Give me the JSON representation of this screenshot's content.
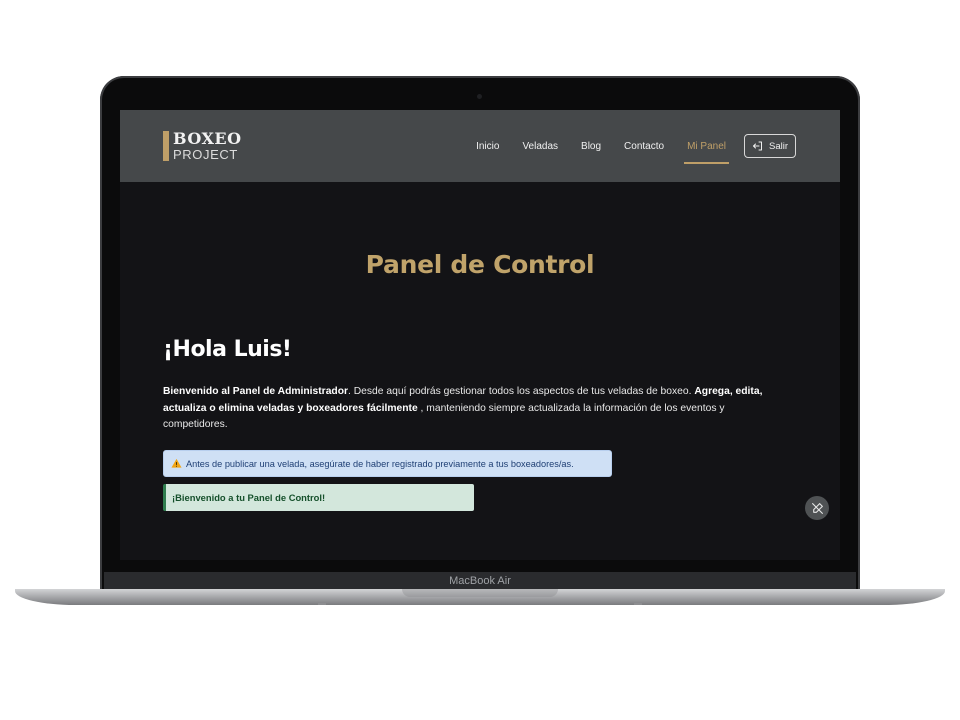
{
  "device": {
    "label": "MacBook Air"
  },
  "brand": {
    "line1": "BOXEO",
    "line2": "PROJECT",
    "accent": "#bf9f68"
  },
  "nav": {
    "items": [
      {
        "label": "Inicio",
        "active": false
      },
      {
        "label": "Veladas",
        "active": false
      },
      {
        "label": "Blog",
        "active": false
      },
      {
        "label": "Contacto",
        "active": false
      },
      {
        "label": "Mi Panel",
        "active": true
      }
    ],
    "logout_label": "Salir",
    "logout_icon": "logout-icon"
  },
  "main": {
    "title": "Panel de Control",
    "greeting": "¡Hola Luis!",
    "intro": {
      "strong1": "Bienvenido al Panel de Administrador",
      "text1": ". Desde aquí podrás gestionar todos los aspectos de tus veladas de boxeo. ",
      "strong2": "Agrega, edita, actualiza o elimina veladas y boxeadores fácilmente",
      "text2": " , manteniendo siempre actualizada la información de los eventos y competidores."
    },
    "alert_info": {
      "icon": "warning-icon",
      "text": "Antes de publicar una velada, asegúrate de haber registrado previamente a tus boxeadores/as."
    },
    "alert_success": {
      "text": "¡Bienvenido a tu Panel de Control!"
    },
    "floating_button_icon": "edit-off-icon"
  },
  "colors": {
    "background": "#131316",
    "navbar": "#45484a",
    "accent": "#bf9f68",
    "info_bg": "#cfe0f5",
    "success_bg": "#d3e7dc"
  }
}
